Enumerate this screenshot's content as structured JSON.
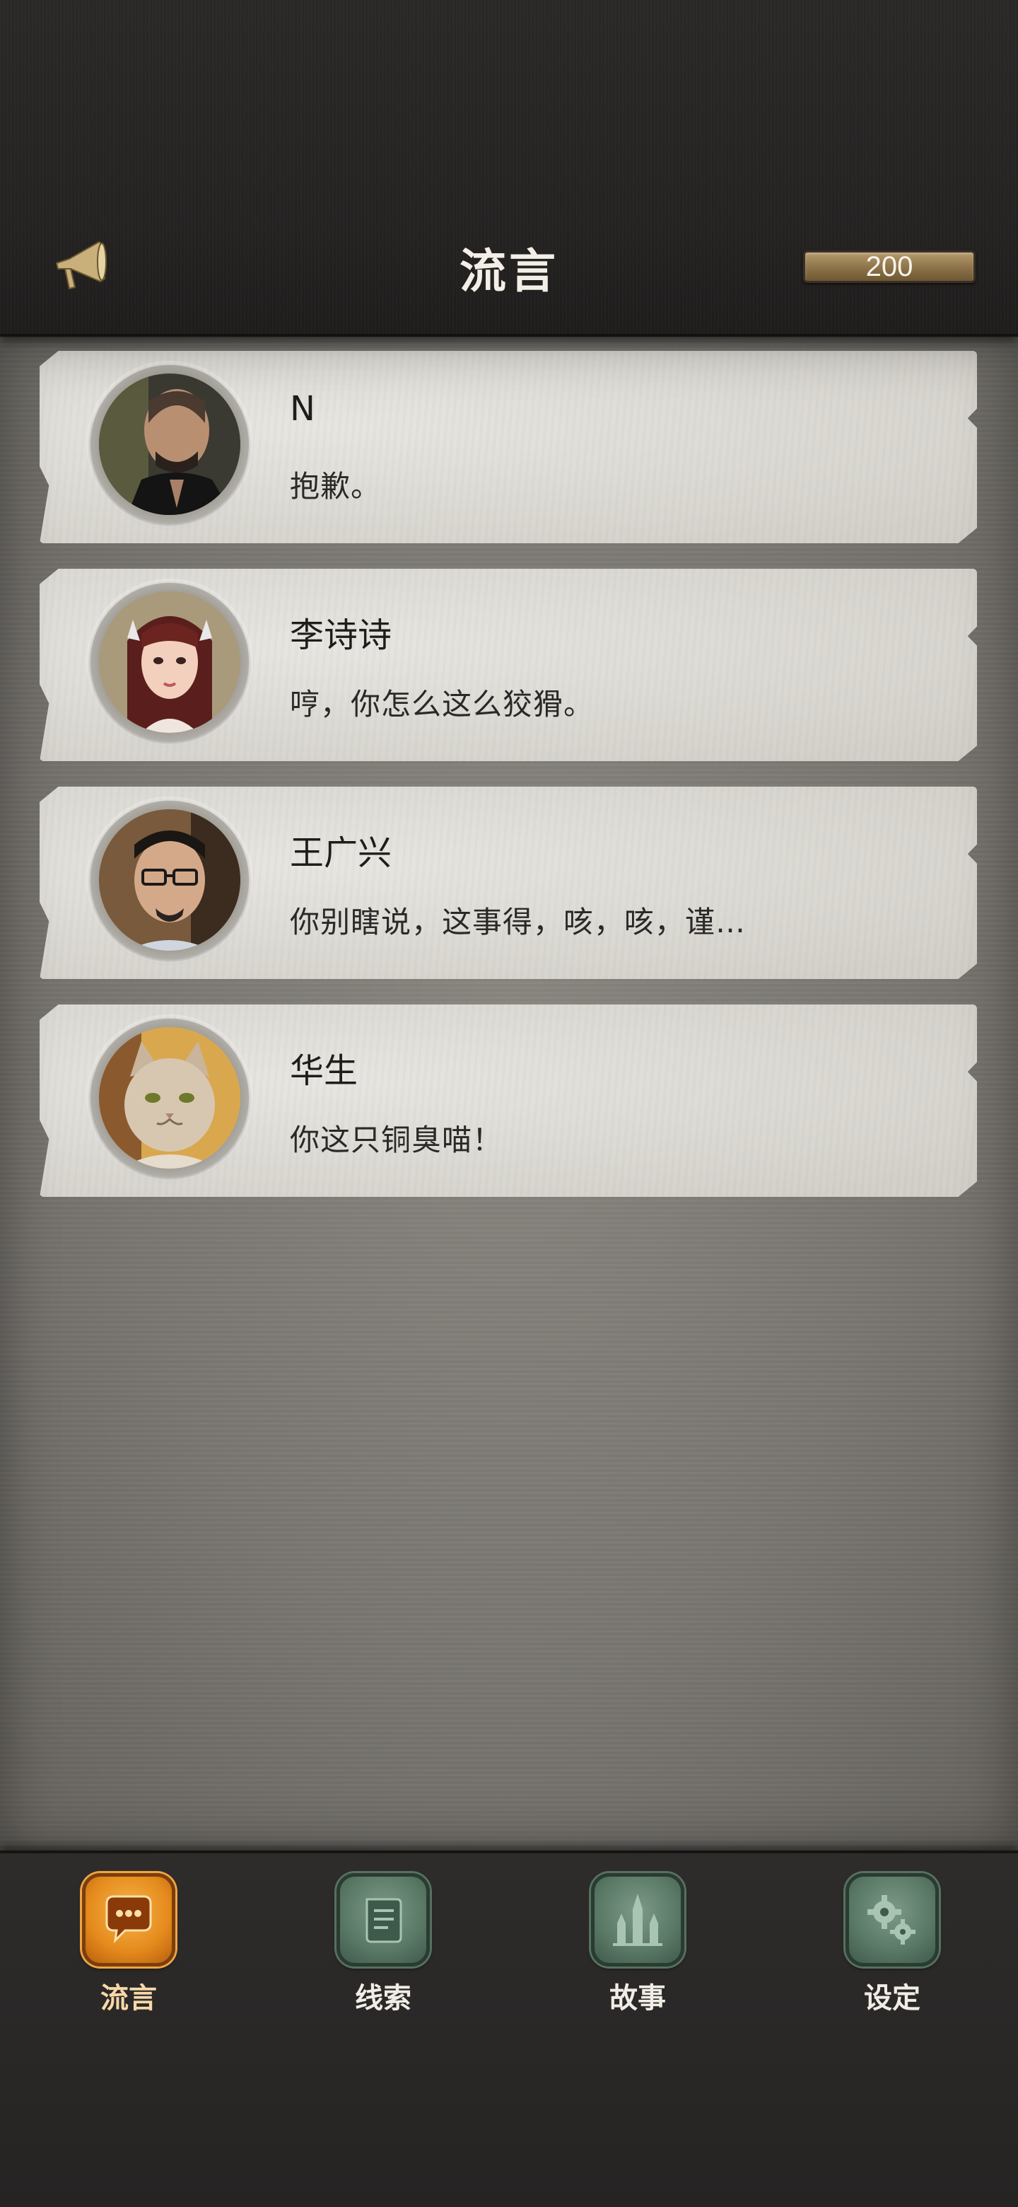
{
  "header": {
    "title": "流言",
    "coins": "200",
    "icons": {
      "left": "megaphone-icon"
    }
  },
  "messages": [
    {
      "name": "N",
      "text": "抱歉。",
      "avatar": "man-dark-avatar"
    },
    {
      "name": "李诗诗",
      "text": "哼，你怎么这么狡猾。",
      "avatar": "girl-avatar"
    },
    {
      "name": "王广兴",
      "text": "你别瞎说，这事得，咳，咳，谨…",
      "avatar": "glasses-man-avatar"
    },
    {
      "name": "华生",
      "text": "你这只铜臭喵！",
      "avatar": "cat-avatar"
    }
  ],
  "nav": [
    {
      "label": "流言",
      "icon": "chat-bubble-icon",
      "active": true
    },
    {
      "label": "线索",
      "icon": "scroll-icon",
      "active": false
    },
    {
      "label": "故事",
      "icon": "cathedral-icon",
      "active": false
    },
    {
      "label": "设定",
      "icon": "gears-icon",
      "active": false
    }
  ],
  "colors": {
    "accent": "#e58a1c",
    "header_bg": "#262423",
    "paper": "#dcdad4",
    "nav_inactive": "#5a7866"
  }
}
